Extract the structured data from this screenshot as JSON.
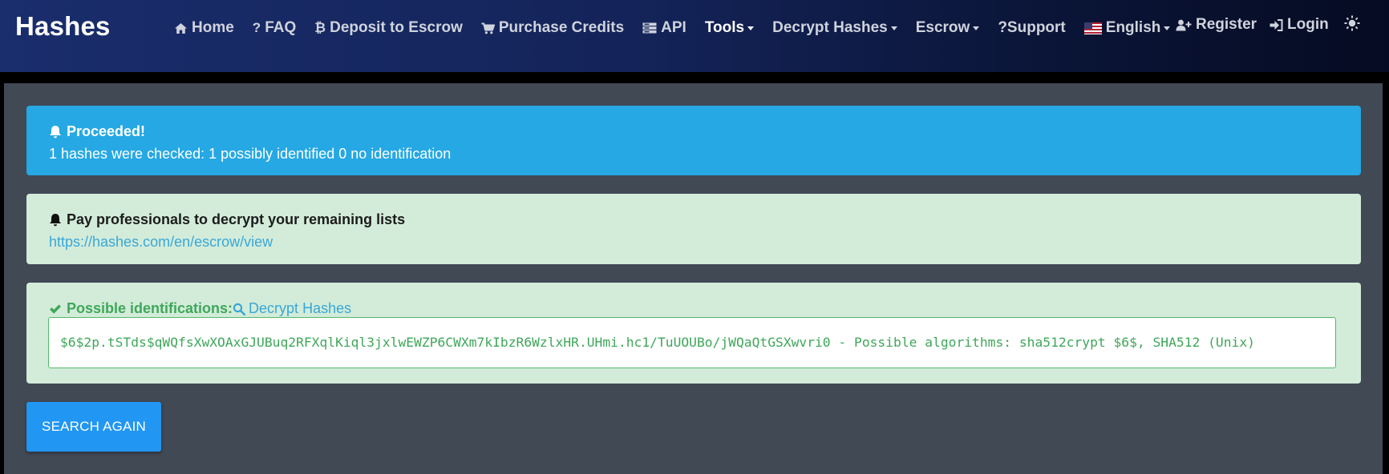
{
  "brand": "Hashes",
  "nav": {
    "home": "Home",
    "faq": "FAQ",
    "deposit": "Deposit to Escrow",
    "purchase": "Purchase Credits",
    "api": "API",
    "tools": "Tools",
    "decrypt": "Decrypt Hashes",
    "escrow": "Escrow",
    "support": "?Support",
    "language": "English",
    "register": "Register",
    "login": "Login"
  },
  "icons": {
    "home": "home-icon",
    "faq": "question-icon",
    "deposit": "bitcoin-icon",
    "purchase": "cart-icon",
    "api": "server-icon",
    "language": "us-flag-icon",
    "register": "user-plus-icon",
    "login": "sign-in-icon",
    "theme": "sun-icon",
    "bell": "bell-icon",
    "check": "check-icon",
    "search": "search-icon"
  },
  "alerts": {
    "proceeded": {
      "title": "Proceeded!",
      "text": "1 hashes were checked: 1 possibly identified 0 no identification"
    },
    "escrow": {
      "title": "Pay professionals to decrypt your remaining lists",
      "link": "https://hashes.com/en/escrow/view"
    },
    "identifications": {
      "title": "Possible identifications:",
      "decrypt_link": "Decrypt Hashes",
      "result": "$6$2p.tSTds$qWQfsXwXOAxGJUBuq2RFXqlKiql3jxlwEWZP6CWXm7kIbzR6WzlxHR.UHmi.hc1/TuUOUBo/jWQaQtGSXwvri0 - Possible algorithms: sha512crypt $6$, SHA512 (Unix)"
    }
  },
  "button": {
    "search_again": "SEARCH AGAIN"
  },
  "colors": {
    "navbar_start": "#1a2d6c",
    "navbar_end": "#050b22",
    "main_bg": "#414955",
    "info": "#25a8e3",
    "success_bg": "#d3ecda",
    "success_text": "#3fa75a",
    "link": "#3aa7d6",
    "button": "#2196f3"
  }
}
